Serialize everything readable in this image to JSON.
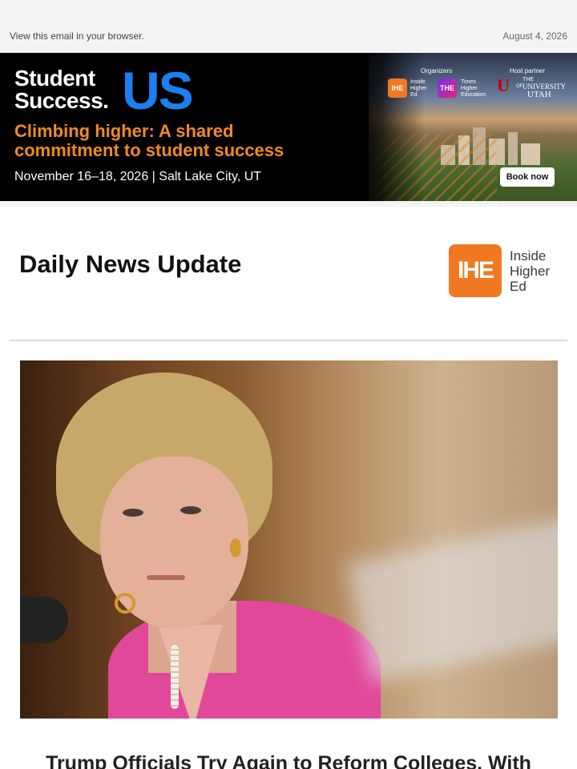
{
  "preheader": {
    "view_in_browser": "View this email in your browser.",
    "date": "August 4, 2026"
  },
  "banner": {
    "brand_line1": "Student",
    "brand_line2": "Success.",
    "brand_us": "US",
    "tagline_line1": "Climbing higher: A shared",
    "tagline_line2": "commitment to student success",
    "dates_location": "November 16–18, 2026 | Salt Lake City, UT",
    "organizers_label": "Organizers",
    "host_partner_label": "Host partner",
    "org1_mark": "IHE",
    "org1_name": [
      "Inside",
      "Higher",
      "Ed"
    ],
    "org2_mark": "THE",
    "org2_name": [
      "Times",
      "Higher",
      "Education"
    ],
    "host_small": "THE",
    "host_university": "UNIVERSITY",
    "host_of": "OF",
    "host_utah": "UTAH",
    "book_now": "Book now",
    "colors": {
      "us": "#1b7ff0",
      "tagline": "#f08a28"
    }
  },
  "newsletter": {
    "title": "Daily News Update",
    "logo_mark": "IHE",
    "logo_text": [
      "Inside",
      "Higher",
      "Ed"
    ],
    "accent": "#f07822"
  },
  "story": {
    "headline_partial": "Trump Officials Try Again to Reform Colleges. With"
  }
}
